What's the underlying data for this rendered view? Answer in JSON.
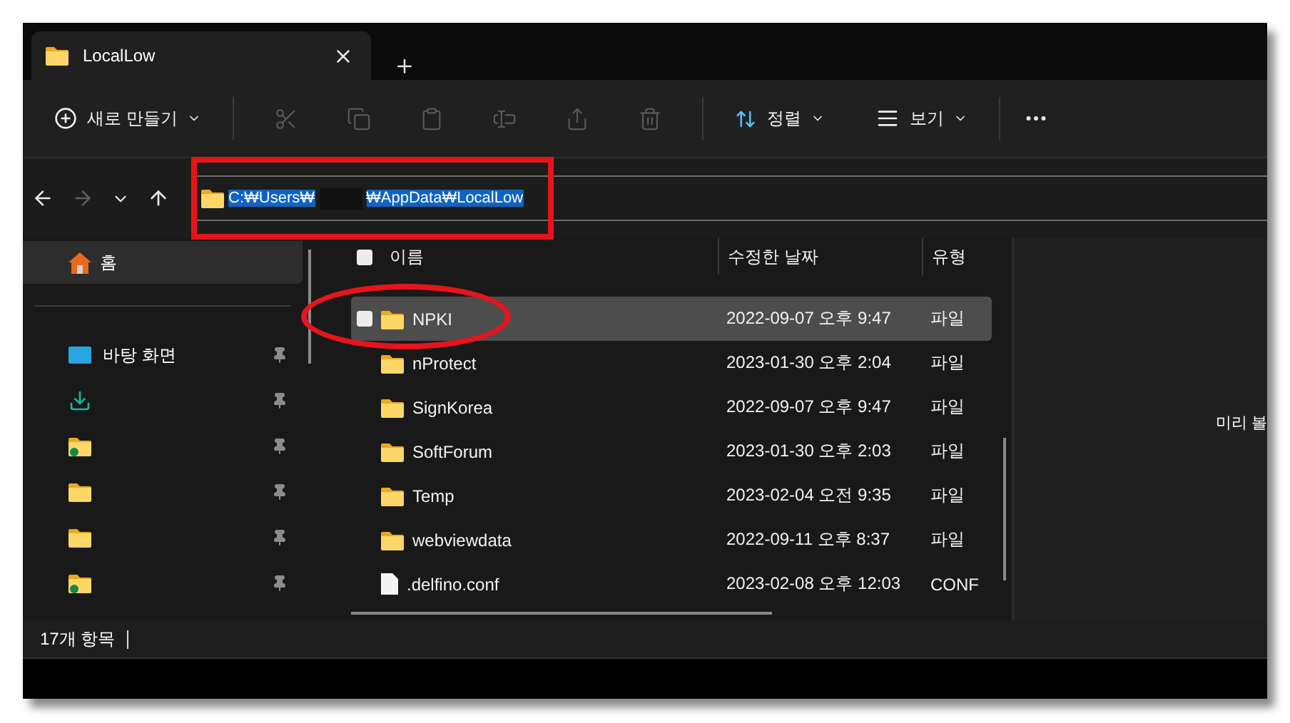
{
  "tab": {
    "title": "LocalLow"
  },
  "toolbar": {
    "new_label": "새로 만들기",
    "actions": [
      {
        "kind": "cut",
        "disabled": true
      },
      {
        "kind": "copy",
        "disabled": true
      },
      {
        "kind": "paste",
        "disabled": true
      },
      {
        "kind": "rename",
        "disabled": true
      },
      {
        "kind": "share",
        "disabled": true
      },
      {
        "kind": "delete",
        "disabled": true
      }
    ],
    "sort_label": "정렬",
    "view_label": "보기"
  },
  "nav": [
    {
      "kind": "back",
      "disabled": false
    },
    {
      "kind": "forward",
      "disabled": true
    },
    {
      "kind": "recent",
      "disabled": false
    },
    {
      "kind": "up",
      "disabled": false
    }
  ],
  "address": {
    "segments": [
      "C:₩Users₩",
      "₩AppData₩LocalLow"
    ],
    "selected": true
  },
  "sidebar": {
    "home": {
      "label": "홈",
      "selected": true
    },
    "items": [
      {
        "kind": "desktop",
        "label": "바탕 화면",
        "pinned": true
      },
      {
        "kind": "download",
        "pinned": true
      },
      {
        "kind": "synced-folder",
        "pinned": true
      },
      {
        "kind": "folder",
        "pinned": true
      },
      {
        "kind": "folder",
        "pinned": true
      },
      {
        "kind": "synced-folder",
        "pinned": true
      }
    ]
  },
  "table": {
    "columns": [
      "이름",
      "수정한 날짜",
      "유형"
    ],
    "select_all": {
      "checked": false
    },
    "rows": [
      {
        "kind": "folder",
        "name": "NPKI",
        "date": "2022-09-07 오후 9:47",
        "type": "파일",
        "selected": true
      },
      {
        "kind": "folder",
        "name": "nProtect",
        "date": "2023-01-30 오후 2:04",
        "type": "파일",
        "selected": false
      },
      {
        "kind": "folder",
        "name": "SignKorea",
        "date": "2022-09-07 오후 9:47",
        "type": "파일",
        "selected": false
      },
      {
        "kind": "folder",
        "name": "SoftForum",
        "date": "2023-01-30 오후 2:03",
        "type": "파일",
        "selected": false
      },
      {
        "kind": "folder",
        "name": "Temp",
        "date": "2023-02-04 오전 9:35",
        "type": "파일",
        "selected": false
      },
      {
        "kind": "folder",
        "name": "webviewdata",
        "date": "2022-09-11 오후 8:37",
        "type": "파일",
        "selected": false
      },
      {
        "kind": "file",
        "name": ".delfino.conf",
        "date": "2023-02-08 오후 12:03",
        "type": "CONF",
        "selected": false
      }
    ]
  },
  "preview": {
    "text": "미리 볼"
  },
  "status_bar": {
    "count": "17개 항목"
  }
}
